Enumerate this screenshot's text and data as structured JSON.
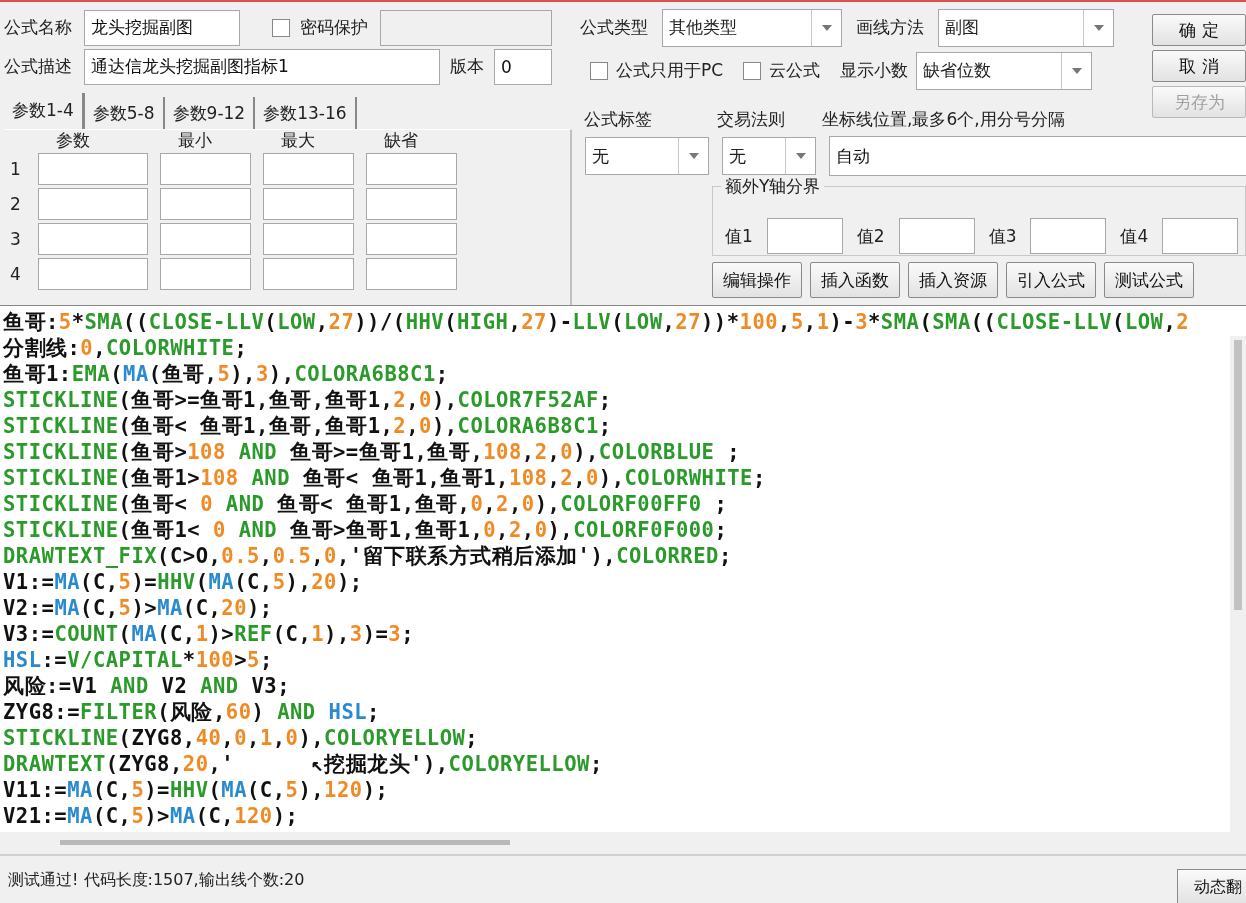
{
  "formula": {
    "name_label": "公式名称",
    "name_value": "龙头挖掘副图",
    "password": {
      "label": "密码保护",
      "checked": false
    },
    "desc_label": "公式描述",
    "desc_value": "通达信龙头挖掘副图指标1",
    "version_label": "版本",
    "version_value": "0"
  },
  "param_tabs": [
    {
      "label": "参数1-4",
      "selected": true
    },
    {
      "label": "参数5-8",
      "selected": false
    },
    {
      "label": "参数9-12",
      "selected": false
    },
    {
      "label": "参数13-16",
      "selected": false
    }
  ],
  "param_columns": [
    "参数",
    "最小",
    "最大",
    "缺省"
  ],
  "param_rows": [
    "1",
    "2",
    "3",
    "4"
  ],
  "type": {
    "label": "公式类型",
    "value": "其他类型"
  },
  "draw_method": {
    "label": "画线方法",
    "value": "副图"
  },
  "pc_only": {
    "label": "公式只用于PC",
    "checked": false
  },
  "cloud": {
    "label": "云公式",
    "checked": false
  },
  "decimals": {
    "label": "显示小数",
    "value": "缺省位数"
  },
  "side_buttons": [
    {
      "label": "确 定",
      "disabled": false
    },
    {
      "label": "取 消",
      "disabled": false
    },
    {
      "label": "另存为",
      "disabled": true
    }
  ],
  "tag": {
    "label": "公式标签",
    "value": "无"
  },
  "trade_rule": {
    "label": "交易法则",
    "value": "无"
  },
  "axis_lines": {
    "label": "坐标线位置,最多6个,用分号分隔",
    "value": "自动"
  },
  "extra_y": {
    "title": "额外Y轴分界",
    "labels": [
      "值1",
      "值2",
      "值3",
      "值4"
    ]
  },
  "action_buttons": [
    "编辑操作",
    "插入函数",
    "插入资源",
    "引入公式",
    "测试公式"
  ],
  "code_lines": [
    [
      {
        "kind": "plain",
        "text": "鱼哥:"
      },
      {
        "kind": "number",
        "text": "5"
      },
      {
        "kind": "plain",
        "text": "*"
      },
      {
        "kind": "function",
        "text": "SMA"
      },
      {
        "kind": "plain",
        "text": "(("
      },
      {
        "kind": "function",
        "text": "CLOSE-LLV"
      },
      {
        "kind": "plain",
        "text": "("
      },
      {
        "kind": "function",
        "text": "LOW"
      },
      {
        "kind": "plain",
        "text": ","
      },
      {
        "kind": "number",
        "text": "27"
      },
      {
        "kind": "plain",
        "text": "))/("
      },
      {
        "kind": "function",
        "text": "HHV"
      },
      {
        "kind": "plain",
        "text": "("
      },
      {
        "kind": "function",
        "text": "HIGH"
      },
      {
        "kind": "plain",
        "text": ","
      },
      {
        "kind": "number",
        "text": "27"
      },
      {
        "kind": "plain",
        "text": ")-"
      },
      {
        "kind": "function",
        "text": "LLV"
      },
      {
        "kind": "plain",
        "text": "("
      },
      {
        "kind": "function",
        "text": "LOW"
      },
      {
        "kind": "plain",
        "text": ","
      },
      {
        "kind": "number",
        "text": "27"
      },
      {
        "kind": "plain",
        "text": "))*"
      },
      {
        "kind": "number",
        "text": "100"
      },
      {
        "kind": "plain",
        "text": ","
      },
      {
        "kind": "number",
        "text": "5"
      },
      {
        "kind": "plain",
        "text": ","
      },
      {
        "kind": "number",
        "text": "1"
      },
      {
        "kind": "plain",
        "text": ")-"
      },
      {
        "kind": "number",
        "text": "3"
      },
      {
        "kind": "plain",
        "text": "*"
      },
      {
        "kind": "function",
        "text": "SMA"
      },
      {
        "kind": "plain",
        "text": "("
      },
      {
        "kind": "function",
        "text": "SMA"
      },
      {
        "kind": "plain",
        "text": "(("
      },
      {
        "kind": "function",
        "text": "CLOSE-LLV"
      },
      {
        "kind": "plain",
        "text": "("
      },
      {
        "kind": "function",
        "text": "LOW"
      },
      {
        "kind": "plain",
        "text": ","
      },
      {
        "kind": "number",
        "text": "2"
      }
    ],
    [
      {
        "kind": "plain",
        "text": "分割线:"
      },
      {
        "kind": "number",
        "text": "0"
      },
      {
        "kind": "plain",
        "text": ","
      },
      {
        "kind": "function",
        "text": "COLORWHITE"
      },
      {
        "kind": "plain",
        "text": ";"
      }
    ],
    [
      {
        "kind": "plain",
        "text": "鱼哥1:"
      },
      {
        "kind": "function",
        "text": "EMA"
      },
      {
        "kind": "plain",
        "text": "("
      },
      {
        "kind": "constant",
        "text": "MA"
      },
      {
        "kind": "plain",
        "text": "(鱼哥,"
      },
      {
        "kind": "number",
        "text": "5"
      },
      {
        "kind": "plain",
        "text": "),"
      },
      {
        "kind": "number",
        "text": "3"
      },
      {
        "kind": "plain",
        "text": "),"
      },
      {
        "kind": "function",
        "text": "COLORA6B8C1"
      },
      {
        "kind": "plain",
        "text": ";"
      }
    ],
    [
      {
        "kind": "function",
        "text": "STICKLINE"
      },
      {
        "kind": "plain",
        "text": "(鱼哥>=鱼哥1,鱼哥,鱼哥1,"
      },
      {
        "kind": "number",
        "text": "2"
      },
      {
        "kind": "plain",
        "text": ","
      },
      {
        "kind": "number",
        "text": "0"
      },
      {
        "kind": "plain",
        "text": "),"
      },
      {
        "kind": "function",
        "text": "COLOR7F52AF"
      },
      {
        "kind": "plain",
        "text": ";"
      }
    ],
    [
      {
        "kind": "function",
        "text": "STICKLINE"
      },
      {
        "kind": "plain",
        "text": "(鱼哥< 鱼哥1,鱼哥,鱼哥1,"
      },
      {
        "kind": "number",
        "text": "2"
      },
      {
        "kind": "plain",
        "text": ","
      },
      {
        "kind": "number",
        "text": "0"
      },
      {
        "kind": "plain",
        "text": "),"
      },
      {
        "kind": "function",
        "text": "COLORA6B8C1"
      },
      {
        "kind": "plain",
        "text": ";"
      }
    ],
    [
      {
        "kind": "function",
        "text": "STICKLINE"
      },
      {
        "kind": "plain",
        "text": "(鱼哥>"
      },
      {
        "kind": "number",
        "text": "108"
      },
      {
        "kind": "function",
        "text": " AND"
      },
      {
        "kind": "plain",
        "text": " 鱼哥>=鱼哥1,鱼哥,"
      },
      {
        "kind": "number",
        "text": "108"
      },
      {
        "kind": "plain",
        "text": ","
      },
      {
        "kind": "number",
        "text": "2"
      },
      {
        "kind": "plain",
        "text": ","
      },
      {
        "kind": "number",
        "text": "0"
      },
      {
        "kind": "plain",
        "text": "),"
      },
      {
        "kind": "function",
        "text": "COLORBLUE"
      },
      {
        "kind": "plain",
        "text": " ;"
      }
    ],
    [
      {
        "kind": "function",
        "text": "STICKLINE"
      },
      {
        "kind": "plain",
        "text": "(鱼哥1>"
      },
      {
        "kind": "number",
        "text": "108"
      },
      {
        "kind": "function",
        "text": " AND"
      },
      {
        "kind": "plain",
        "text": " 鱼哥< 鱼哥1,鱼哥1,"
      },
      {
        "kind": "number",
        "text": "108"
      },
      {
        "kind": "plain",
        "text": ","
      },
      {
        "kind": "number",
        "text": "2"
      },
      {
        "kind": "plain",
        "text": ","
      },
      {
        "kind": "number",
        "text": "0"
      },
      {
        "kind": "plain",
        "text": "),"
      },
      {
        "kind": "function",
        "text": "COLORWHITE"
      },
      {
        "kind": "plain",
        "text": ";"
      }
    ],
    [
      {
        "kind": "function",
        "text": "STICKLINE"
      },
      {
        "kind": "plain",
        "text": "(鱼哥< "
      },
      {
        "kind": "number",
        "text": "0"
      },
      {
        "kind": "function",
        "text": " AND"
      },
      {
        "kind": "plain",
        "text": " 鱼哥< 鱼哥1,鱼哥,"
      },
      {
        "kind": "number",
        "text": "0"
      },
      {
        "kind": "plain",
        "text": ","
      },
      {
        "kind": "number",
        "text": "2"
      },
      {
        "kind": "plain",
        "text": ","
      },
      {
        "kind": "number",
        "text": "0"
      },
      {
        "kind": "plain",
        "text": "),"
      },
      {
        "kind": "function",
        "text": "COLORF00FF0"
      },
      {
        "kind": "plain",
        "text": " ;"
      }
    ],
    [
      {
        "kind": "function",
        "text": "STICKLINE"
      },
      {
        "kind": "plain",
        "text": "(鱼哥1< "
      },
      {
        "kind": "number",
        "text": "0"
      },
      {
        "kind": "function",
        "text": " AND"
      },
      {
        "kind": "plain",
        "text": " 鱼哥>鱼哥1,鱼哥1,"
      },
      {
        "kind": "number",
        "text": "0"
      },
      {
        "kind": "plain",
        "text": ","
      },
      {
        "kind": "number",
        "text": "2"
      },
      {
        "kind": "plain",
        "text": ","
      },
      {
        "kind": "number",
        "text": "0"
      },
      {
        "kind": "plain",
        "text": "),"
      },
      {
        "kind": "function",
        "text": "COLORF0F000"
      },
      {
        "kind": "plain",
        "text": ";"
      }
    ],
    [
      {
        "kind": "function",
        "text": "DRAWTEXT_FIX"
      },
      {
        "kind": "plain",
        "text": "(C>O,"
      },
      {
        "kind": "number",
        "text": "0.5"
      },
      {
        "kind": "plain",
        "text": ","
      },
      {
        "kind": "number",
        "text": "0.5"
      },
      {
        "kind": "plain",
        "text": ","
      },
      {
        "kind": "number",
        "text": "0"
      },
      {
        "kind": "plain",
        "text": ",'留下联系方式稍后添加'),"
      },
      {
        "kind": "function",
        "text": "COLORRED"
      },
      {
        "kind": "plain",
        "text": ";"
      }
    ],
    [
      {
        "kind": "plain",
        "text": "V1:="
      },
      {
        "kind": "constant",
        "text": "MA"
      },
      {
        "kind": "plain",
        "text": "(C,"
      },
      {
        "kind": "number",
        "text": "5"
      },
      {
        "kind": "plain",
        "text": ")="
      },
      {
        "kind": "function",
        "text": "HHV"
      },
      {
        "kind": "plain",
        "text": "("
      },
      {
        "kind": "constant",
        "text": "MA"
      },
      {
        "kind": "plain",
        "text": "(C,"
      },
      {
        "kind": "number",
        "text": "5"
      },
      {
        "kind": "plain",
        "text": "),"
      },
      {
        "kind": "number",
        "text": "20"
      },
      {
        "kind": "plain",
        "text": ");"
      }
    ],
    [
      {
        "kind": "plain",
        "text": "V2:="
      },
      {
        "kind": "constant",
        "text": "MA"
      },
      {
        "kind": "plain",
        "text": "(C,"
      },
      {
        "kind": "number",
        "text": "5"
      },
      {
        "kind": "plain",
        "text": ")>"
      },
      {
        "kind": "constant",
        "text": "MA"
      },
      {
        "kind": "plain",
        "text": "(C,"
      },
      {
        "kind": "number",
        "text": "20"
      },
      {
        "kind": "plain",
        "text": ");"
      }
    ],
    [
      {
        "kind": "plain",
        "text": "V3:="
      },
      {
        "kind": "function",
        "text": "COUNT"
      },
      {
        "kind": "plain",
        "text": "("
      },
      {
        "kind": "constant",
        "text": "MA"
      },
      {
        "kind": "plain",
        "text": "(C,"
      },
      {
        "kind": "number",
        "text": "1"
      },
      {
        "kind": "plain",
        "text": ")>"
      },
      {
        "kind": "function",
        "text": "REF"
      },
      {
        "kind": "plain",
        "text": "(C,"
      },
      {
        "kind": "number",
        "text": "1"
      },
      {
        "kind": "plain",
        "text": "),"
      },
      {
        "kind": "number",
        "text": "3"
      },
      {
        "kind": "plain",
        "text": ")="
      },
      {
        "kind": "number",
        "text": "3"
      },
      {
        "kind": "plain",
        "text": ";"
      }
    ],
    [
      {
        "kind": "constant",
        "text": "HSL"
      },
      {
        "kind": "plain",
        "text": ":="
      },
      {
        "kind": "function",
        "text": "V/CAPITAL"
      },
      {
        "kind": "plain",
        "text": "*"
      },
      {
        "kind": "number",
        "text": "100"
      },
      {
        "kind": "plain",
        "text": ">"
      },
      {
        "kind": "number",
        "text": "5"
      },
      {
        "kind": "plain",
        "text": ";"
      }
    ],
    [
      {
        "kind": "plain",
        "text": "风险:=V1 "
      },
      {
        "kind": "function",
        "text": "AND"
      },
      {
        "kind": "plain",
        "text": " V2 "
      },
      {
        "kind": "function",
        "text": "AND"
      },
      {
        "kind": "plain",
        "text": " V3;"
      }
    ],
    [
      {
        "kind": "plain",
        "text": "ZYG8:="
      },
      {
        "kind": "function",
        "text": "FILTER"
      },
      {
        "kind": "plain",
        "text": "(风险,"
      },
      {
        "kind": "number",
        "text": "60"
      },
      {
        "kind": "plain",
        "text": ") "
      },
      {
        "kind": "function",
        "text": "AND"
      },
      {
        "kind": "constant",
        "text": " HSL"
      },
      {
        "kind": "plain",
        "text": ";"
      }
    ],
    [
      {
        "kind": "function",
        "text": "STICKLINE"
      },
      {
        "kind": "plain",
        "text": "(ZYG8,"
      },
      {
        "kind": "number",
        "text": "40"
      },
      {
        "kind": "plain",
        "text": ","
      },
      {
        "kind": "number",
        "text": "0"
      },
      {
        "kind": "plain",
        "text": ","
      },
      {
        "kind": "number",
        "text": "1"
      },
      {
        "kind": "plain",
        "text": ","
      },
      {
        "kind": "number",
        "text": "0"
      },
      {
        "kind": "plain",
        "text": "),"
      },
      {
        "kind": "function",
        "text": "COLORYELLOW"
      },
      {
        "kind": "plain",
        "text": ";"
      }
    ],
    [
      {
        "kind": "function",
        "text": "DRAWTEXT"
      },
      {
        "kind": "plain",
        "text": "(ZYG8,"
      },
      {
        "kind": "number",
        "text": "20"
      },
      {
        "kind": "plain",
        "text": ",'      ↖挖掘龙头'),"
      },
      {
        "kind": "function",
        "text": "COLORYELLOW"
      },
      {
        "kind": "plain",
        "text": ";"
      }
    ],
    [
      {
        "kind": "plain",
        "text": "V11:="
      },
      {
        "kind": "constant",
        "text": "MA"
      },
      {
        "kind": "plain",
        "text": "(C,"
      },
      {
        "kind": "number",
        "text": "5"
      },
      {
        "kind": "plain",
        "text": ")="
      },
      {
        "kind": "function",
        "text": "HHV"
      },
      {
        "kind": "plain",
        "text": "("
      },
      {
        "kind": "constant",
        "text": "MA"
      },
      {
        "kind": "plain",
        "text": "(C,"
      },
      {
        "kind": "number",
        "text": "5"
      },
      {
        "kind": "plain",
        "text": "),"
      },
      {
        "kind": "number",
        "text": "120"
      },
      {
        "kind": "plain",
        "text": ");"
      }
    ],
    [
      {
        "kind": "plain",
        "text": "V21:="
      },
      {
        "kind": "constant",
        "text": "MA"
      },
      {
        "kind": "plain",
        "text": "(C,"
      },
      {
        "kind": "number",
        "text": "5"
      },
      {
        "kind": "plain",
        "text": ")>"
      },
      {
        "kind": "constant",
        "text": "MA"
      },
      {
        "kind": "plain",
        "text": "(C,"
      },
      {
        "kind": "number",
        "text": "120"
      },
      {
        "kind": "plain",
        "text": ");"
      }
    ]
  ],
  "status": {
    "message": "测试通过! 代码长度:1507,输出线个数:20",
    "button": "动态翻"
  }
}
